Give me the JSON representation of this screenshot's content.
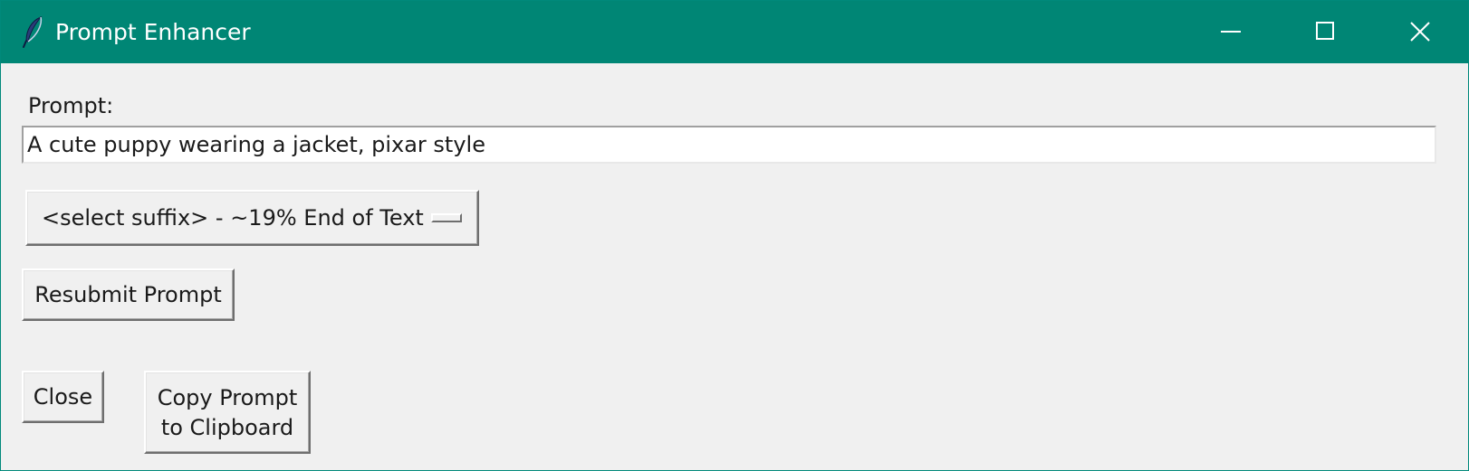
{
  "window": {
    "title": "Prompt Enhancer",
    "titlebar_color": "#008675",
    "icon": "feather-icon"
  },
  "controls": {
    "minimize_icon": "minimize-icon",
    "maximize_icon": "maximize-icon",
    "close_icon": "close-icon"
  },
  "form": {
    "prompt_label": "Prompt:",
    "prompt_value": "A cute puppy wearing a jacket, pixar style",
    "suffix_selected": "<select suffix> - ~19% End of Text",
    "resubmit_label": "Resubmit Prompt",
    "close_label": "Close",
    "copy_label_line1": "Copy Prompt",
    "copy_label_line2": "to Clipboard"
  }
}
